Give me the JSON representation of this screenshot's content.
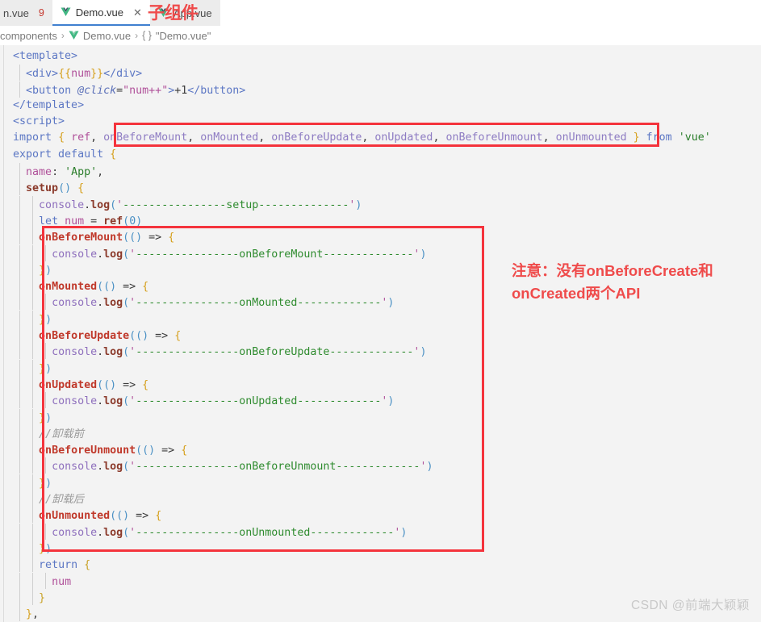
{
  "colors": {
    "accent_red": "#f4333c",
    "note_red": "#ef4b4b",
    "active_tab_underline": "#4080d0",
    "editor_bg": "#f3f3f3",
    "tab_inactive_bg": "#ececec",
    "watermark": "#c8c8c8",
    "error_count": "#c4352b"
  },
  "tabs": [
    {
      "label": "n.vue",
      "icon": "vue-file-icon",
      "badge": "9",
      "active": false,
      "close": ""
    },
    {
      "label": "Demo.vue",
      "icon": "vue-file-icon",
      "badge": "",
      "active": true,
      "close": "✕"
    },
    {
      "label": "App.vue",
      "icon": "vue-file-icon",
      "badge": "",
      "active": false,
      "close": ""
    }
  ],
  "breadcrumb": {
    "items": [
      {
        "label": "components",
        "icon": ""
      },
      {
        "label": "Demo.vue",
        "icon": "vue-file-icon"
      },
      {
        "label": "\"Demo.vue\"",
        "icon": "braces-icon",
        "braces": "{ }"
      }
    ],
    "separator": "›"
  },
  "annotations": {
    "child_component": "子组件",
    "api_note_line1": "注意：没有onBeforeCreate和",
    "api_note_line2": "onCreated两个API"
  },
  "watermark": "CSDN @前端大颖颖",
  "code": {
    "lines": [
      {
        "id": "l1",
        "text": "  <template>"
      },
      {
        "id": "l2",
        "text": "    <div>{{num}}</div>"
      },
      {
        "id": "l3",
        "text": "    <button @click=\"num++\">+1</button>"
      },
      {
        "id": "l4",
        "text": "  </template>"
      },
      {
        "id": "l5",
        "text": "  <script>"
      },
      {
        "id": "l6",
        "text": "  import { ref, onBeforeMount, onMounted, onBeforeUpdate, onUpdated, onBeforeUnmount, onUnmounted } from 'vue'"
      },
      {
        "id": "l7",
        "text": "  export default {"
      },
      {
        "id": "l8",
        "text": "    name: 'App',"
      },
      {
        "id": "l9",
        "text": "    setup() {"
      },
      {
        "id": "l10",
        "text": "      console.log('----------------setup--------------')"
      },
      {
        "id": "l11",
        "text": "      let num = ref(0)"
      },
      {
        "id": "l12",
        "text": "      onBeforeMount(() => {"
      },
      {
        "id": "l13",
        "text": "        console.log('----------------onBeforeMount--------------')"
      },
      {
        "id": "l14",
        "text": "      })"
      },
      {
        "id": "l15",
        "text": "      onMounted(() => {"
      },
      {
        "id": "l16",
        "text": "        console.log('----------------onMounted-------------')"
      },
      {
        "id": "l17",
        "text": "      })"
      },
      {
        "id": "l18",
        "text": "      onBeforeUpdate(() => {"
      },
      {
        "id": "l19",
        "text": "        console.log('----------------onBeforeUpdate-------------')"
      },
      {
        "id": "l20",
        "text": "      })"
      },
      {
        "id": "l21",
        "text": "      onUpdated(() => {"
      },
      {
        "id": "l22",
        "text": "        console.log('----------------onUpdated-------------')"
      },
      {
        "id": "l23",
        "text": "      })"
      },
      {
        "id": "l24",
        "text": "      //卸载前"
      },
      {
        "id": "l25",
        "text": "      onBeforeUnmount(() => {"
      },
      {
        "id": "l26",
        "text": "        console.log('----------------onBeforeUnmount-------------')"
      },
      {
        "id": "l27",
        "text": "      })"
      },
      {
        "id": "l28",
        "text": "      //卸载后"
      },
      {
        "id": "l29",
        "text": "      onUnmounted(() => {"
      },
      {
        "id": "l30",
        "text": "        console.log('----------------onUnmounted-------------')"
      },
      {
        "id": "l31",
        "text": "      })"
      },
      {
        "id": "l32",
        "text": "      return {"
      },
      {
        "id": "l33",
        "text": "        num"
      },
      {
        "id": "l34",
        "text": "      }"
      },
      {
        "id": "l35",
        "text": "    },"
      }
    ]
  }
}
